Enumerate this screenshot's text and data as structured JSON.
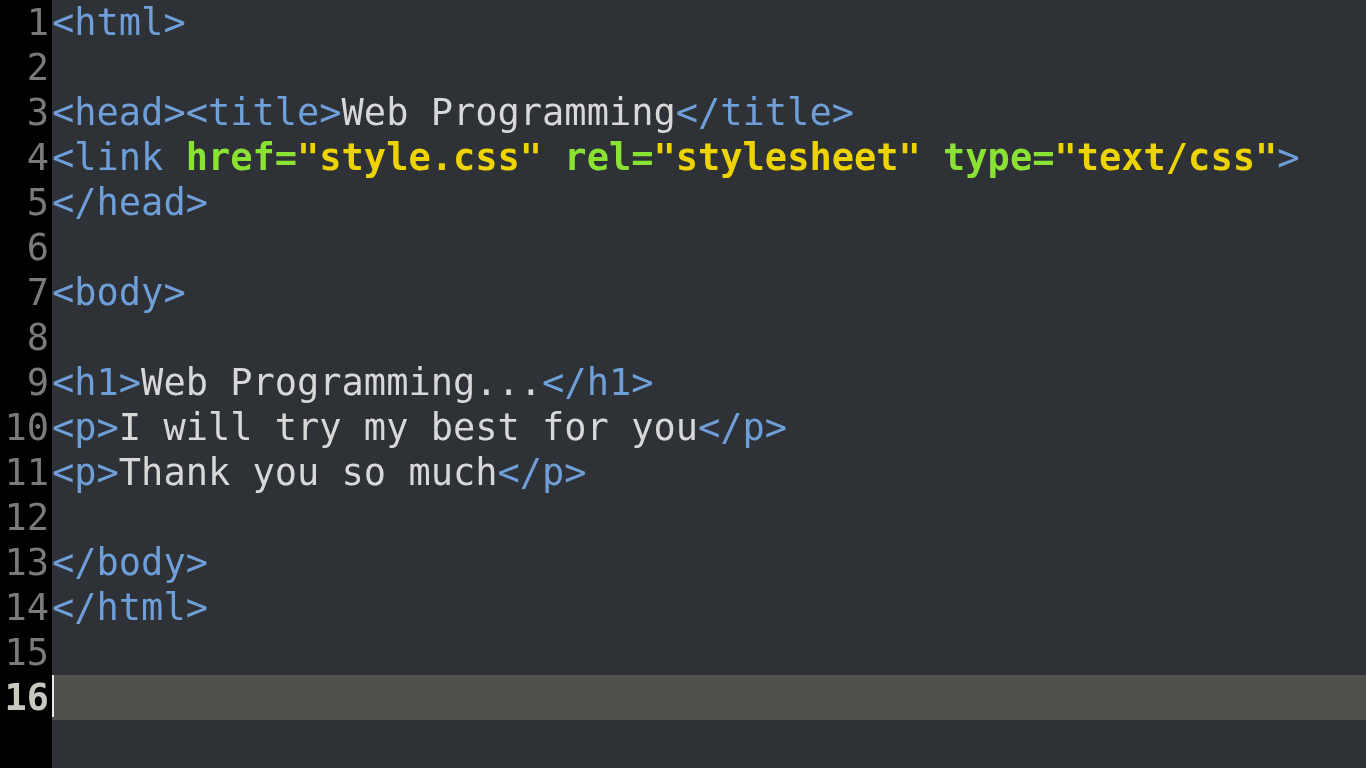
{
  "editor": {
    "lines": [
      {
        "number": "1",
        "current": false,
        "tokens": [
          {
            "kind": "tag",
            "text": "<html>"
          }
        ]
      },
      {
        "number": "2",
        "current": false
      },
      {
        "number": "3",
        "current": false,
        "tokens": [
          {
            "kind": "tag",
            "text": "<head><title>"
          },
          {
            "kind": "text",
            "text": "Web Programming"
          },
          {
            "kind": "tag",
            "text": "</title>"
          }
        ]
      },
      {
        "number": "4",
        "current": false,
        "tokens": [
          {
            "kind": "tag",
            "text": "<link "
          },
          {
            "kind": "attr",
            "text": "href="
          },
          {
            "kind": "string",
            "text": "\"style.css\""
          },
          {
            "kind": "attr",
            "text": " rel="
          },
          {
            "kind": "string",
            "text": "\"stylesheet\""
          },
          {
            "kind": "attr",
            "text": " type="
          },
          {
            "kind": "string",
            "text": "\"text/css\""
          },
          {
            "kind": "tag",
            "text": ">"
          }
        ]
      },
      {
        "number": "5",
        "current": false,
        "tokens": [
          {
            "kind": "tag",
            "text": "</head>"
          }
        ]
      },
      {
        "number": "6",
        "current": false
      },
      {
        "number": "7",
        "current": false,
        "tokens": [
          {
            "kind": "tag",
            "text": "<body>"
          }
        ]
      },
      {
        "number": "8",
        "current": false
      },
      {
        "number": "9",
        "current": false,
        "tokens": [
          {
            "kind": "tag",
            "text": "<h1>"
          },
          {
            "kind": "text",
            "text": "Web Programming..."
          },
          {
            "kind": "tag",
            "text": "</h1>"
          }
        ]
      },
      {
        "number": "10",
        "current": false,
        "tokens": [
          {
            "kind": "tag",
            "text": "<p>"
          },
          {
            "kind": "text",
            "text": "I will try my best for you"
          },
          {
            "kind": "tag",
            "text": "</p>"
          }
        ]
      },
      {
        "number": "11",
        "current": false,
        "tokens": [
          {
            "kind": "tag",
            "text": "<p>"
          },
          {
            "kind": "text",
            "text": "Thank you so much"
          },
          {
            "kind": "tag",
            "text": "</p>"
          }
        ]
      },
      {
        "number": "12",
        "current": false
      },
      {
        "number": "13",
        "current": false,
        "tokens": [
          {
            "kind": "tag",
            "text": "</body>"
          }
        ]
      },
      {
        "number": "14",
        "current": false,
        "tokens": [
          {
            "kind": "tag",
            "text": "</html>"
          }
        ]
      },
      {
        "number": "15",
        "current": false
      },
      {
        "number": "16",
        "current": true
      }
    ]
  }
}
